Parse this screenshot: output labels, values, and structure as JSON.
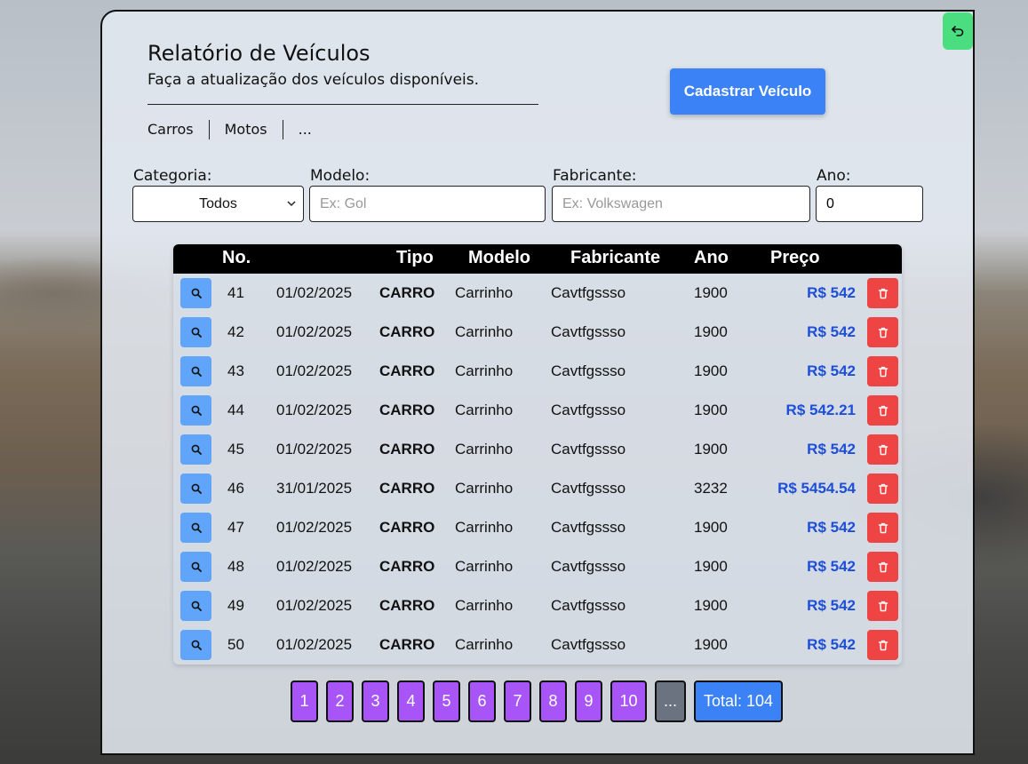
{
  "header": {
    "title": "Relatório de Veículos",
    "subtitle": "Faça a atualização dos veículos disponíveis.",
    "register_button": "Cadastrar Veículo"
  },
  "tabs": [
    "Carros",
    "Motos",
    "..."
  ],
  "filters": {
    "categoria_label": "Categoria:",
    "categoria_value": "Todos",
    "modelo_label": "Modelo:",
    "modelo_placeholder": "Ex: Gol",
    "fabricante_label": "Fabricante:",
    "fabricante_placeholder": "Ex: Volkswagen",
    "ano_label": "Ano:",
    "ano_value": "0"
  },
  "table": {
    "headers": {
      "no": "No.",
      "tipo": "Tipo",
      "modelo": "Modelo",
      "fabricante": "Fabricante",
      "ano": "Ano",
      "preco": "Preço"
    },
    "rows": [
      {
        "no": "41",
        "data": "01/02/2025",
        "tipo": "CARRO",
        "modelo": "Carrinho",
        "fabricante": "Cavtfgssso",
        "ano": "1900",
        "preco": "R$ 542"
      },
      {
        "no": "42",
        "data": "01/02/2025",
        "tipo": "CARRO",
        "modelo": "Carrinho",
        "fabricante": "Cavtfgssso",
        "ano": "1900",
        "preco": "R$ 542"
      },
      {
        "no": "43",
        "data": "01/02/2025",
        "tipo": "CARRO",
        "modelo": "Carrinho",
        "fabricante": "Cavtfgssso",
        "ano": "1900",
        "preco": "R$ 542"
      },
      {
        "no": "44",
        "data": "01/02/2025",
        "tipo": "CARRO",
        "modelo": "Carrinho",
        "fabricante": "Cavtfgssso",
        "ano": "1900",
        "preco": "R$ 542.21"
      },
      {
        "no": "45",
        "data": "01/02/2025",
        "tipo": "CARRO",
        "modelo": "Carrinho",
        "fabricante": "Cavtfgssso",
        "ano": "1900",
        "preco": "R$ 542"
      },
      {
        "no": "46",
        "data": "31/01/2025",
        "tipo": "CARRO",
        "modelo": "Carrinho",
        "fabricante": "Cavtfgssso",
        "ano": "3232",
        "preco": "R$ 5454.54"
      },
      {
        "no": "47",
        "data": "01/02/2025",
        "tipo": "CARRO",
        "modelo": "Carrinho",
        "fabricante": "Cavtfgssso",
        "ano": "1900",
        "preco": "R$ 542"
      },
      {
        "no": "48",
        "data": "01/02/2025",
        "tipo": "CARRO",
        "modelo": "Carrinho",
        "fabricante": "Cavtfgssso",
        "ano": "1900",
        "preco": "R$ 542"
      },
      {
        "no": "49",
        "data": "01/02/2025",
        "tipo": "CARRO",
        "modelo": "Carrinho",
        "fabricante": "Cavtfgssso",
        "ano": "1900",
        "preco": "R$ 542"
      },
      {
        "no": "50",
        "data": "01/02/2025",
        "tipo": "CARRO",
        "modelo": "Carrinho",
        "fabricante": "Cavtfgssso",
        "ano": "1900",
        "preco": "R$ 542"
      }
    ]
  },
  "pagination": {
    "pages": [
      "1",
      "2",
      "3",
      "4",
      "5",
      "6",
      "7",
      "8",
      "9",
      "10"
    ],
    "more": "...",
    "total": "Total: 104"
  },
  "colors": {
    "primary": "#3b82f6",
    "success": "#4ade80",
    "danger": "#ef4444",
    "page": "#a855f7",
    "price": "#1d4ed8"
  },
  "icons": {
    "back": "undo-arrow-icon",
    "view": "search-icon",
    "delete": "trash-icon"
  }
}
